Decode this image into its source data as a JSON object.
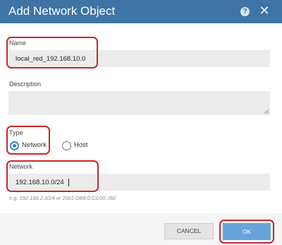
{
  "dialog": {
    "title": "Add Network Object",
    "help_icon": "help-icon",
    "close_icon": "close-icon"
  },
  "form": {
    "name_label": "Name",
    "name_value": "local_red_192.168.10.0",
    "description_label": "Description",
    "description_value": "",
    "type_label": "Type",
    "type_options": [
      "Network",
      "Host"
    ],
    "type_selected": "Network",
    "network_label": "Network",
    "network_value": "192.168.10.0/24",
    "network_hint": "e.g. 192.168.2.0/24 or 2001:DB8:0:CD30::/60"
  },
  "buttons": {
    "cancel": "CANCEL",
    "ok": "OK"
  },
  "colors": {
    "titlebar": "#3f74a6",
    "highlight": "#c9262c",
    "ok_button": "#68a4dc",
    "radio_selected": "#3a86c8"
  }
}
